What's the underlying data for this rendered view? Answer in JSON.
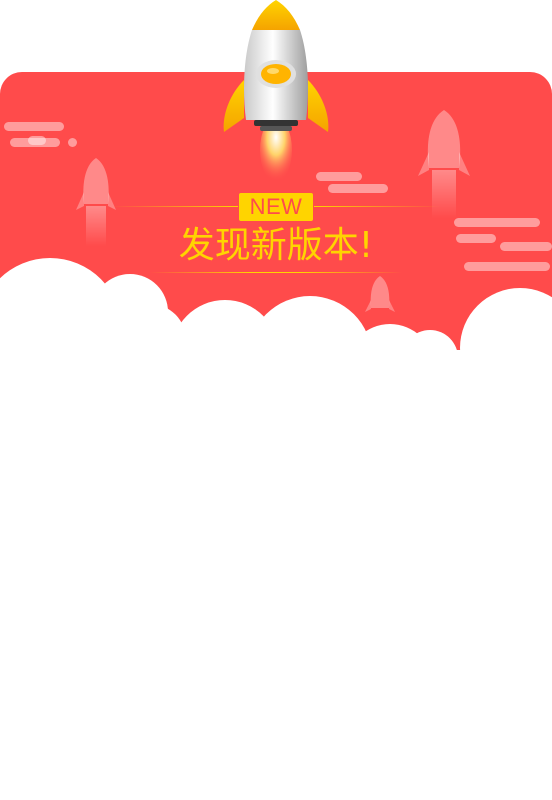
{
  "popup": {
    "badge_text": "NEW",
    "headline": "发现新版本!"
  },
  "colors": {
    "banner_red": "#ff4b4b",
    "accent_yellow": "#ffd400",
    "background": "#ffffff"
  },
  "icons": {
    "main": "rocket-icon",
    "decorative": "rocket-silhouette-icon"
  }
}
